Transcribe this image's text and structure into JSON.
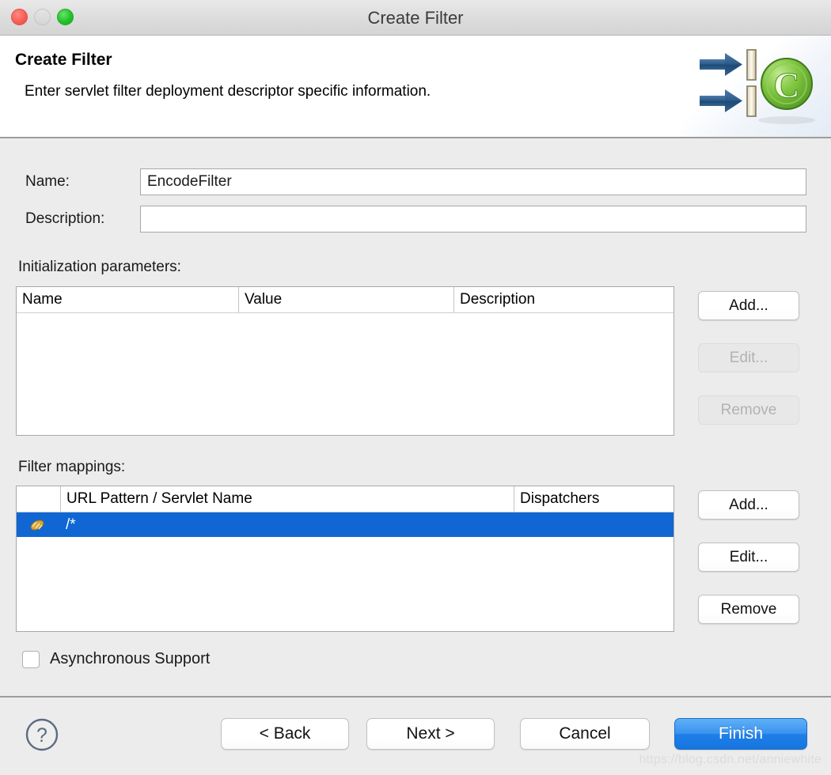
{
  "window": {
    "title": "Create Filter",
    "controls": {
      "close": "close-button",
      "minimize": "minimize-button",
      "maximize": "maximize-button"
    }
  },
  "header": {
    "title": "Create Filter",
    "description": "Enter servlet filter deployment descriptor specific information.",
    "icon": "servlet-filter-banner-icon"
  },
  "form": {
    "name": {
      "label": "Name:",
      "value": "EncodeFilter",
      "placeholder": ""
    },
    "description": {
      "label": "Description:",
      "value": "",
      "placeholder": ""
    }
  },
  "init_params": {
    "label": "Initialization parameters:",
    "columns": [
      "Name",
      "Value",
      "Description"
    ],
    "rows": [],
    "buttons": [
      {
        "label": "Add...",
        "enabled": true
      },
      {
        "label": "Edit...",
        "enabled": false
      },
      {
        "label": "Remove",
        "enabled": false
      }
    ]
  },
  "filter_mappings": {
    "label": "Filter mappings:",
    "columns": [
      "",
      "URL Pattern / Servlet Name",
      "Dispatchers"
    ],
    "rows": [
      {
        "icon": "url-pattern-icon",
        "pattern": "/*",
        "dispatchers": "",
        "selected": true
      }
    ],
    "buttons": [
      {
        "label": "Add...",
        "enabled": true
      },
      {
        "label": "Edit...",
        "enabled": true
      },
      {
        "label": "Remove",
        "enabled": true
      }
    ]
  },
  "async": {
    "label": "Asynchronous Support",
    "checked": false
  },
  "footer": {
    "help": "help-icon",
    "buttons": [
      {
        "label": "< Back",
        "primary": false
      },
      {
        "label": "Next >",
        "primary": false
      },
      {
        "label": "Cancel",
        "primary": false
      },
      {
        "label": "Finish",
        "primary": true
      }
    ]
  },
  "watermark": "https://blog.csdn.net/anniewhite",
  "colors": {
    "selection_blue": "#1067d3",
    "primary_button": "#2b88e8",
    "window_bg": "#ececec",
    "traffic_close": "#fa5e55",
    "traffic_min": "#d8d8d8",
    "traffic_max": "#21c229"
  }
}
